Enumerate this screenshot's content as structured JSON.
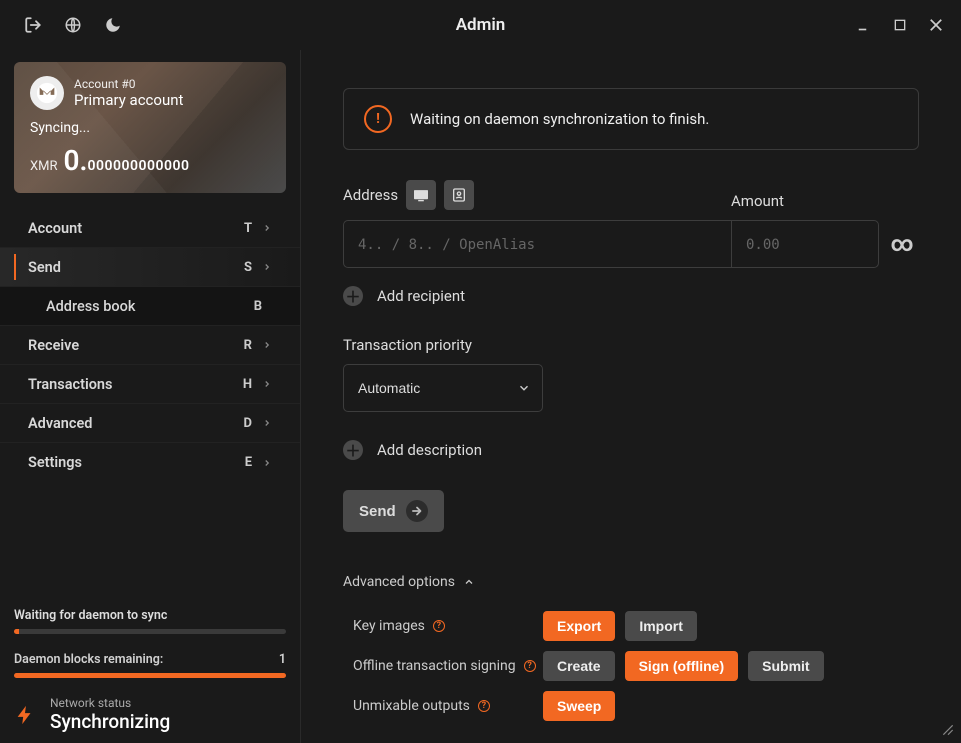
{
  "colors": {
    "accent": "#f26822"
  },
  "titlebar": {
    "title": "Admin"
  },
  "account": {
    "tag": "Account #0",
    "name": "Primary account",
    "status": "Syncing...",
    "currency": "XMR",
    "balance_whole": "0.",
    "balance_frac": "000000000000"
  },
  "nav": {
    "account": {
      "label": "Account",
      "shortcut": "T"
    },
    "send": {
      "label": "Send",
      "shortcut": "S"
    },
    "address_book": {
      "label": "Address book",
      "shortcut": "B"
    },
    "receive": {
      "label": "Receive",
      "shortcut": "R"
    },
    "transactions": {
      "label": "Transactions",
      "shortcut": "H"
    },
    "advanced": {
      "label": "Advanced",
      "shortcut": "D"
    },
    "settings": {
      "label": "Settings",
      "shortcut": "E"
    }
  },
  "sidebar_status": {
    "line1": "Waiting for daemon to sync",
    "progress1_percent": 2,
    "line2_label": "Daemon blocks remaining:",
    "line2_value": "1",
    "progress2_percent": 100,
    "network_status_label": "Network status",
    "network_status_value": "Synchronizing"
  },
  "alert": {
    "message": "Waiting on daemon synchronization to finish."
  },
  "form": {
    "address_label": "Address",
    "address_placeholder": "4.. / 8.. / OpenAlias",
    "amount_label": "Amount",
    "amount_placeholder": "0.00",
    "add_recipient": "Add recipient",
    "tx_priority_label": "Transaction priority",
    "tx_priority_value": "Automatic",
    "add_description": "Add description",
    "send_button": "Send"
  },
  "advanced": {
    "toggle_label": "Advanced options",
    "key_images_label": "Key images",
    "export_btn": "Export",
    "import_btn": "Import",
    "offline_signing_label": "Offline transaction signing",
    "create_btn": "Create",
    "sign_btn": "Sign (offline)",
    "submit_btn": "Submit",
    "unmixable_label": "Unmixable outputs",
    "sweep_btn": "Sweep"
  }
}
